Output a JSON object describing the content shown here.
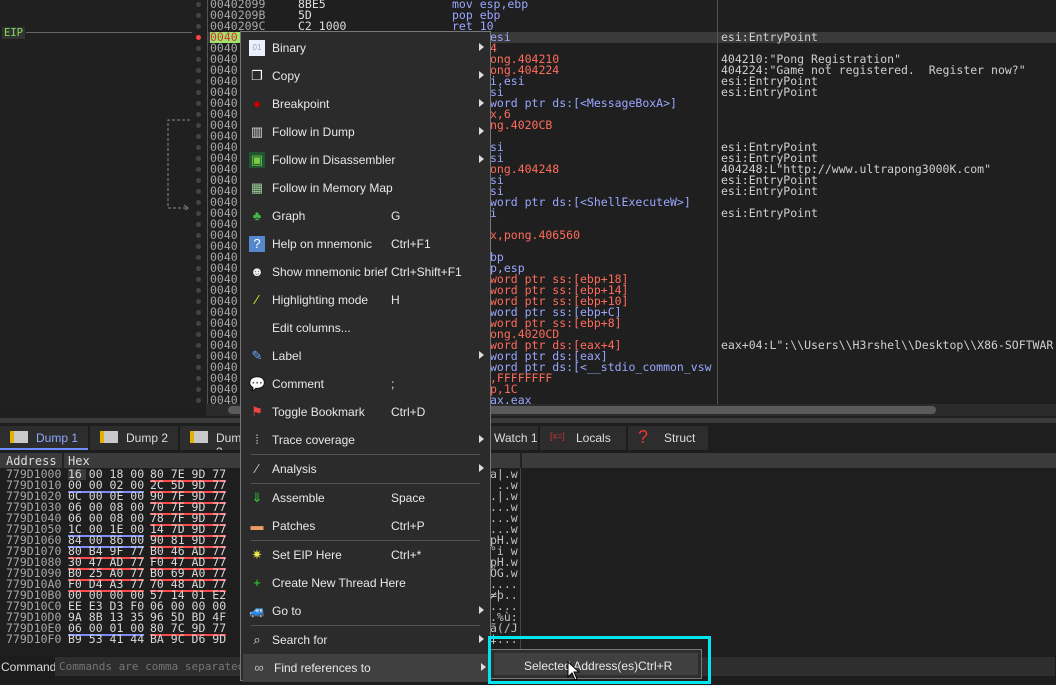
{
  "disasm": {
    "eip_label": "EIP",
    "top_rows": [
      {
        "addr": "00402099",
        "bytes": "8BE5",
        "ins": "mov esp,ebp"
      },
      {
        "addr": "0040209B",
        "bytes": "5D",
        "ins": "pop ebp"
      },
      {
        "addr": "0040209C",
        "bytes": "C2 1000",
        "ins": "ret 10",
        "red": "10"
      }
    ],
    "addr_prefix": "0040",
    "rows": [
      {
        "tail": "esi",
        "comment": "esi:EntryPoint"
      },
      {
        "tail": "4",
        "comment": ""
      },
      {
        "tail": "ong.404210",
        "comment": "404210:\"Pong Registration\""
      },
      {
        "tail": "ong.404224",
        "comment": "404224:\"Game not registered.  Register now?\""
      },
      {
        "tail": "i,esi",
        "comment": "esi:EntryPoint"
      },
      {
        "tail": "si",
        "comment": "esi:EntryPoint"
      },
      {
        "tail": "word ptr ds:[<MessageBoxA>]",
        "comment": ""
      },
      {
        "tail": "x,6",
        "comment": ""
      },
      {
        "tail": "ng.4020CB",
        "comment": ""
      },
      {
        "tail": "",
        "comment": ""
      },
      {
        "tail": "si",
        "comment": "esi:EntryPoint"
      },
      {
        "tail": "si",
        "comment": "esi:EntryPoint"
      },
      {
        "tail": "ong.404248",
        "comment": "404248:L\"http://www.ultrapong3000K.com\""
      },
      {
        "tail": "si",
        "comment": "esi:EntryPoint"
      },
      {
        "tail": "si",
        "comment": "esi:EntryPoint"
      },
      {
        "tail": "word ptr ds:[<ShellExecuteW>]",
        "comment": ""
      },
      {
        "tail": "i",
        "comment": "esi:EntryPoint"
      },
      {
        "tail": "",
        "comment": ""
      },
      {
        "tail": "x,pong.406560",
        "comment": ""
      },
      {
        "tail": "",
        "comment": ""
      },
      {
        "tail": "bp",
        "comment": ""
      },
      {
        "tail": "p,esp",
        "comment": ""
      },
      {
        "tail": "word ptr ss:[ebp+18]",
        "comment": ""
      },
      {
        "tail": "word ptr ss:[ebp+14]",
        "comment": ""
      },
      {
        "tail": "word ptr ss:[ebp+10]",
        "comment": ""
      },
      {
        "tail": "word ptr ss:[ebp+C]",
        "comment": ""
      },
      {
        "tail": "word ptr ss:[ebp+8]",
        "comment": ""
      },
      {
        "tail": "ong.4020CD",
        "comment": ""
      },
      {
        "tail": "word ptr ds:[eax+4]",
        "comment": "eax+04:L\":\\\\Users\\\\H3rshel\\\\Desktop\\\\X86-SOFTWAR"
      },
      {
        "tail": "word ptr ds:[eax]",
        "comment": ""
      },
      {
        "tail": "word ptr ds:[<__stdio_common_vsw",
        "comment": ""
      },
      {
        "tail": ",FFFFFFFF",
        "comment": ""
      },
      {
        "tail": "p,1C",
        "comment": ""
      },
      {
        "tail": "ax,eax",
        "comment": ""
      }
    ]
  },
  "tabs": [
    {
      "label": "Dump 1",
      "active": true
    },
    {
      "label": "Dump 2"
    },
    {
      "label": "Dump 3"
    },
    {
      "label": "Watch 1"
    },
    {
      "label": "Locals"
    },
    {
      "label": "Struct"
    }
  ],
  "dump": {
    "headers": [
      "Address",
      "Hex"
    ],
    "rows": [
      {
        "addr": "779D1000",
        "g1": "16 00 18 00",
        "u1": "",
        "g2": "80 7E 9D 77",
        "u2": "red",
        "asc": "a|.w"
      },
      {
        "addr": "779D1010",
        "g1": "00 00 02 00",
        "u1": "blue",
        "g2": "2C 5D 9D 77",
        "u2": "red",
        "asc": " ..w"
      },
      {
        "addr": "779D1020",
        "g1": "0C 00 0E 00",
        "u1": "",
        "g2": "90 7F 9D 77",
        "u2": "red",
        "asc": ".|.w"
      },
      {
        "addr": "779D1030",
        "g1": "06 00 08 00",
        "u1": "",
        "g2": "70 7F 9D 77",
        "u2": "red",
        "asc": "...w"
      },
      {
        "addr": "779D1040",
        "g1": "06 00 08 00",
        "u1": "",
        "g2": "78 7F 9D 77",
        "u2": "red",
        "asc": "...w"
      },
      {
        "addr": "779D1050",
        "g1": "1C 00 1E 00",
        "u1": "blue",
        "g2": "14 7D 9D 77",
        "u2": "red",
        "asc": "...w"
      },
      {
        "addr": "779D1060",
        "g1": "84 00 86 00",
        "u1": "blue",
        "g2": "90 81 9D 77",
        "u2": "red",
        "asc": "pH.w"
      },
      {
        "addr": "779D1070",
        "g1": "80 B4 9F 77",
        "u1": "red",
        "g2": "B0 46 AD 77",
        "u2": "red",
        "asc": "°i w"
      },
      {
        "addr": "779D1080",
        "g1": "30 47 AD 77",
        "u1": "red",
        "g2": "F0 47 AD 77",
        "u2": "red",
        "asc": "pH.w"
      },
      {
        "addr": "779D1090",
        "g1": "B0 25 A0 77",
        "u1": "red",
        "g2": "B0 69 A0 77",
        "u2": "red",
        "asc": "ÖG.w"
      },
      {
        "addr": "779D10A0",
        "g1": "F0 D4 A3 77",
        "u1": "red",
        "g2": "70 48 AD 77",
        "u2": "red",
        "asc": "...."
      },
      {
        "addr": "779D10B0",
        "g1": "00 00 00 00",
        "u1": "",
        "g2": "57 14 01 E2",
        "u2": "",
        "asc": "≠þ.."
      },
      {
        "addr": "779D10C0",
        "g1": "EE E3 D3 F0",
        "u1": "",
        "g2": "06 00 00 00",
        "u2": "",
        "asc": "...."
      },
      {
        "addr": "779D10D0",
        "g1": "9A 8B 13 35",
        "u1": "",
        "g2": "96 5D BD 4F",
        "u2": "",
        "asc": ".%ù:"
      },
      {
        "addr": "779D10E0",
        "g1": "06 00 01 00",
        "u1": "blue",
        "g2": "80 7C 9D 77",
        "u2": "red",
        "asc": "ã(/J"
      },
      {
        "addr": "779D10F0",
        "g1": "B9 53 41 44",
        "u1": "",
        "g2": "BA 9C D6 9D",
        "u2": "",
        "asc": "‡:.."
      }
    ]
  },
  "command": {
    "label": "Command:",
    "placeholder": "Commands are comma separated (like assembly instructions): mov eax, ebx"
  },
  "menu": [
    {
      "label": "Binary",
      "icon": "binary-icon",
      "sub": true
    },
    {
      "label": "Copy",
      "icon": "copy-icon",
      "sub": true
    },
    {
      "label": "Breakpoint",
      "icon": "breakpoint-icon",
      "sub": true
    },
    {
      "label": "Follow in Dump",
      "icon": "dump-icon",
      "sub": true
    },
    {
      "label": "Follow in Disassembler",
      "icon": "cpu-icon",
      "sub": true
    },
    {
      "label": "Follow in Memory Map",
      "icon": "memory-map-icon"
    },
    {
      "label": "Graph",
      "icon": "tree-icon",
      "shortcut": "G"
    },
    {
      "label": "Help on mnemonic",
      "icon": "help-icon",
      "shortcut": "Ctrl+F1"
    },
    {
      "label": "Show mnemonic brief",
      "icon": "penguin-icon",
      "shortcut": "Ctrl+Shift+F1"
    },
    {
      "label": "Highlighting mode",
      "icon": "highlighter-icon",
      "shortcut": "H"
    },
    {
      "label": "Edit columns...",
      "icon": ""
    },
    {
      "label": "Label",
      "icon": "label-icon",
      "sub": true
    },
    {
      "label": "Comment",
      "icon": "comment-icon",
      "shortcut": ";"
    },
    {
      "label": "Toggle Bookmark",
      "icon": "bookmark-icon",
      "shortcut": "Ctrl+D"
    },
    {
      "label": "Trace coverage",
      "icon": "footprints-icon",
      "sub": true,
      "sep_after": true
    },
    {
      "label": "Analysis",
      "icon": "wand-icon",
      "sub": true,
      "sep_after": true
    },
    {
      "label": "Assemble",
      "icon": "assemble-icon",
      "shortcut": "Space"
    },
    {
      "label": "Patches",
      "icon": "bandage-icon",
      "shortcut": "Ctrl+P",
      "sep_after": true
    },
    {
      "label": "Set EIP Here",
      "icon": "star-icon",
      "shortcut": "Ctrl+*"
    },
    {
      "label": "Create New Thread Here",
      "icon": "new-thread-icon"
    },
    {
      "label": "Go to",
      "icon": "car-icon",
      "sub": true,
      "sep_after": true
    },
    {
      "label": "Search for",
      "icon": "search-icon",
      "sub": true
    },
    {
      "label": "Find references to",
      "icon": "binoculars-icon",
      "sub": true,
      "highlighted": true
    }
  ],
  "submenu": {
    "label": "Selected Address(es)",
    "shortcut": "Ctrl+R"
  },
  "colors": {
    "highlight_box": "#00e5ee",
    "eip_addr_bg": "#9be36a",
    "register": "#9aa7ff",
    "constant": "#ff6c5c"
  }
}
